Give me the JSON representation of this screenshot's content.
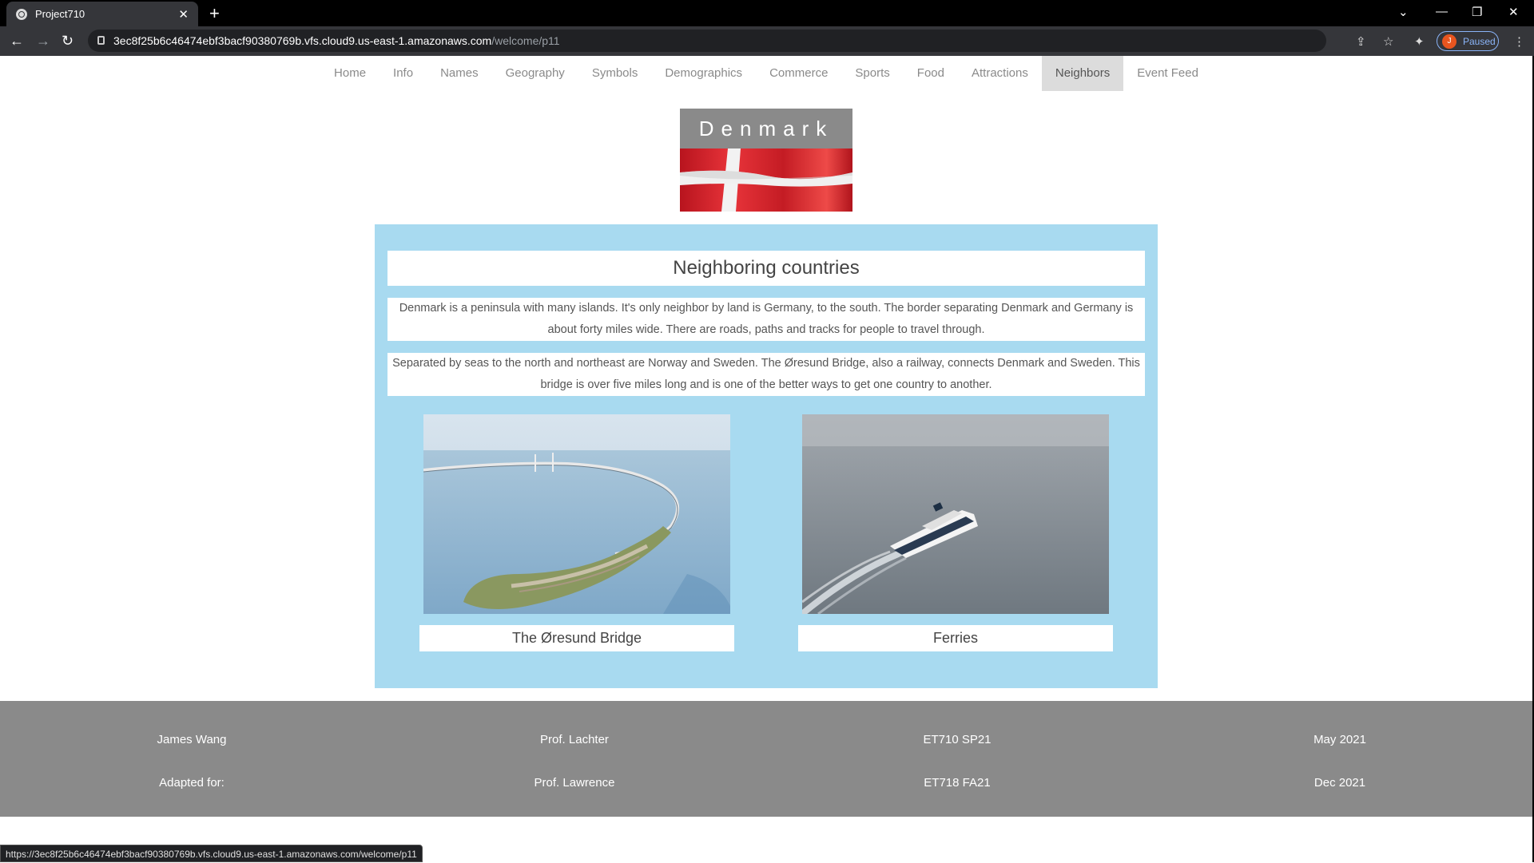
{
  "browser": {
    "tab_title": "Project710",
    "url_host": "3ec8f25b6c46474ebf3bacf90380769b.vfs.cloud9.us-east-1.amazonaws.com",
    "url_path": "/welcome/p11",
    "profile_initial": "J",
    "profile_status": "Paused",
    "status_url": "https://3ec8f25b6c46474ebf3bacf90380769b.vfs.cloud9.us-east-1.amazonaws.com/welcome/p11"
  },
  "nav": {
    "items": [
      "Home",
      "Info",
      "Names",
      "Geography",
      "Symbols",
      "Demographics",
      "Commerce",
      "Sports",
      "Food",
      "Attractions",
      "Neighbors",
      "Event Feed"
    ],
    "active": "Neighbors"
  },
  "header": {
    "country": "Denmark"
  },
  "main": {
    "title": "Neighboring countries",
    "paragraph1": "Denmark is a peninsula with many islands. It's only neighbor by land is Germany, to the south. The border separating Denmark and Germany is about forty miles wide. There are roads, paths and tracks for people to travel through.",
    "paragraph2": "Separated by seas to the north and northeast are Norway and Sweden. The Øresund Bridge, also a railway, connects Denmark and Sweden. This bridge is over five miles long and is one of the better ways to get one country to another.",
    "caption1": "The Øresund Bridge",
    "caption2": "Ferries"
  },
  "footer": {
    "row1": [
      "James Wang",
      "Prof. Lachter",
      "ET710 SP21",
      "May 2021"
    ],
    "row2": [
      "Adapted for:",
      "Prof. Lawrence",
      "ET718 FA21",
      "Dec 2021"
    ]
  },
  "colors": {
    "panel": "#a8daf0",
    "footer": "#8a8a8a",
    "flag_red": "#d8202a"
  }
}
